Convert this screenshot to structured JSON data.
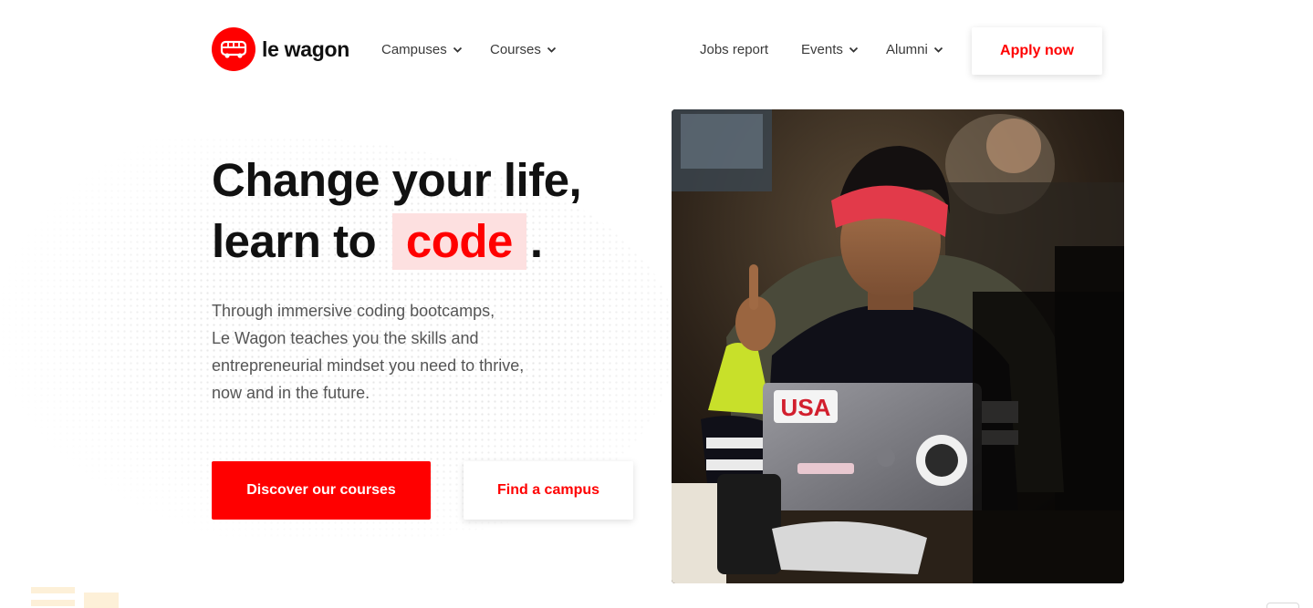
{
  "brand": {
    "name": "le wagon",
    "accent": "#ff0000",
    "highlight_bg": "#fde0e0"
  },
  "nav": {
    "left": [
      {
        "label": "Campuses",
        "icon": "chevron-down-icon"
      },
      {
        "label": "Courses",
        "icon": "chevron-down-icon"
      }
    ],
    "right": [
      {
        "label": "Jobs report"
      },
      {
        "label": "Events",
        "icon": "chevron-down-icon"
      },
      {
        "label": "Alumni",
        "icon": "chevron-down-icon"
      }
    ],
    "cta": "Apply now"
  },
  "hero": {
    "headline_line1": "Change your life,",
    "headline_line2_prefix": "learn to",
    "headline_highlight": "code",
    "headline_suffix": ".",
    "subtext_lines": [
      "Through immersive coding bootcamps,",
      "Le Wagon teaches you the skills and",
      "entrepreneurial mindset you need to thrive,",
      "now and in the future."
    ],
    "primary_button": "Discover our courses",
    "secondary_button": "Find a campus",
    "photo_sticker_text": "USA"
  }
}
